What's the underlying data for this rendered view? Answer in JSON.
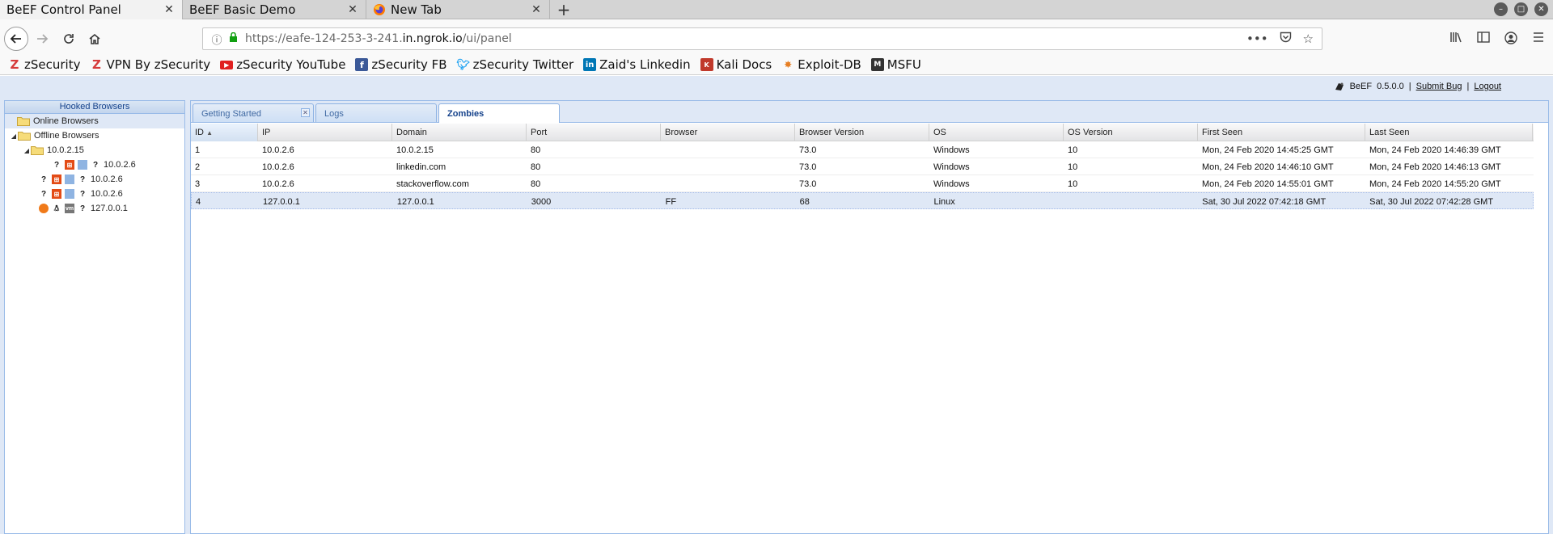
{
  "browser": {
    "tabs": [
      {
        "title": "BeEF Control Panel",
        "active": true
      },
      {
        "title": "BeEF Basic Demo",
        "active": false
      },
      {
        "title": "New Tab",
        "active": false,
        "favicon": "firefox-icon"
      }
    ],
    "url_prefix": "https://eafe-124-253-3-241.",
    "url_host": "in.ngrok.io",
    "url_path": "/ui/panel",
    "bookmarks": [
      {
        "label": "zSecurity",
        "icon": "zsecurity-icon",
        "color": "#d63b3b"
      },
      {
        "label": "VPN By zSecurity",
        "icon": "zsecurity-icon",
        "color": "#d63b3b"
      },
      {
        "label": "zSecurity YouTube",
        "icon": "youtube-icon",
        "color": "#e02020"
      },
      {
        "label": "zSecurity FB",
        "icon": "facebook-icon",
        "color": "#3b5998"
      },
      {
        "label": "zSecurity Twitter",
        "icon": "twitter-icon",
        "color": "#1da1f2"
      },
      {
        "label": "Zaid's Linkedin",
        "icon": "linkedin-icon",
        "color": "#0077b5"
      },
      {
        "label": "Kali Docs",
        "icon": "kali-icon",
        "color": "#c0392b"
      },
      {
        "label": "Exploit-DB",
        "icon": "exploitdb-icon",
        "color": "#e67e22"
      },
      {
        "label": "MSFU",
        "icon": "msfu-icon",
        "color": "#333333"
      }
    ]
  },
  "beef": {
    "product": "BeEF",
    "version": "0.5.0.0",
    "separator": "|",
    "submit_bug": "Submit Bug",
    "logout": "Logout",
    "west_title": "Hooked Browsers",
    "tree": {
      "online": "Online Browsers",
      "offline": "Offline Browsers",
      "subnet": "10.0.2.15",
      "nodes": [
        "10.0.2.6",
        "10.0.2.6",
        "10.0.2.6",
        "127.0.0.1"
      ]
    },
    "tabs": [
      "Getting Started",
      "Logs",
      "Zombies"
    ],
    "columns": [
      "ID",
      "IP",
      "Domain",
      "Port",
      "Browser",
      "Browser Version",
      "OS",
      "OS Version",
      "First Seen",
      "Last Seen"
    ],
    "rows": [
      [
        "1",
        "10.0.2.6",
        "10.0.2.15",
        "80",
        "",
        "73.0",
        "Windows",
        "10",
        "Mon, 24 Feb 2020 14:45:25 GMT",
        "Mon, 24 Feb 2020 14:46:39 GMT"
      ],
      [
        "2",
        "10.0.2.6",
        "linkedin.com",
        "80",
        "",
        "73.0",
        "Windows",
        "10",
        "Mon, 24 Feb 2020 14:46:10 GMT",
        "Mon, 24 Feb 2020 14:46:13 GMT"
      ],
      [
        "3",
        "10.0.2.6",
        "stackoverflow.com",
        "80",
        "",
        "73.0",
        "Windows",
        "10",
        "Mon, 24 Feb 2020 14:55:01 GMT",
        "Mon, 24 Feb 2020 14:55:20 GMT"
      ],
      [
        "4",
        "127.0.0.1",
        "127.0.0.1",
        "3000",
        "FF",
        "68",
        "Linux",
        "",
        "Sat, 30 Jul 2022 07:42:18 GMT",
        "Sat, 30 Jul 2022 07:42:28 GMT"
      ]
    ],
    "selected_row": 3
  }
}
